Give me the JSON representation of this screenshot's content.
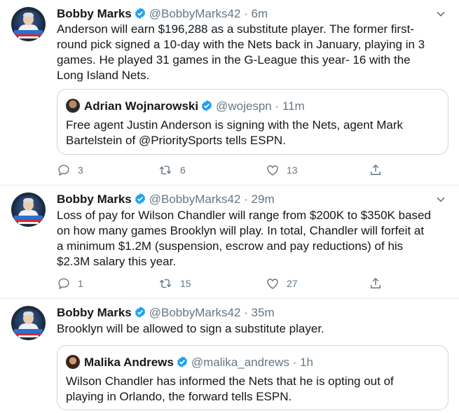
{
  "tweets": [
    {
      "name": "Bobby Marks",
      "handle": "@BobbyMarks42",
      "time": "6m",
      "lines": [
        "Anderson will earn $196,288 as a substitute player. The former first-",
        "round pick signed a 10-day with the Nets back in January, playing in 3",
        "games. He played 31 games in the G-League this year- 16 with the",
        "Long Island Nets."
      ],
      "quote": {
        "name": "Adrian Wojnarowski",
        "handle": "@wojespn",
        "time": "11m",
        "lines": [
          "Free agent Justin Anderson is signing with the Nets, agent Mark",
          "Bartelstein of @PrioritySports tells ESPN."
        ]
      },
      "replies": "3",
      "retweets": "6",
      "likes": "13"
    },
    {
      "name": "Bobby Marks",
      "handle": "@BobbyMarks42",
      "time": "29m",
      "lines": [
        "Loss of pay for Wilson Chandler will range from $200K to $350K based",
        "on how many games Brooklyn will play. In total, Chandler will forfeit at",
        "a minimum $1.2M (suspension, escrow and pay reductions) of his",
        "$2.3M salary this year."
      ],
      "replies": "1",
      "retweets": "15",
      "likes": "27"
    },
    {
      "name": "Bobby Marks",
      "handle": "@BobbyMarks42",
      "time": "35m",
      "lines": [
        "Brooklyn will be allowed to sign a substitute player."
      ],
      "quote": {
        "name": "Malika Andrews",
        "handle": "@malika_andrews",
        "time": "1h",
        "lines": [
          "Wilson Chandler has informed the Nets that he is opting out of",
          "playing in Orlando, the forward tells ESPN."
        ]
      }
    }
  ],
  "separator": "·",
  "icons": {
    "verified": "verified-badge-icon",
    "more": "chevron-down-icon",
    "reply": "reply-icon",
    "retweet": "retweet-icon",
    "like": "heart-icon",
    "share": "share-icon"
  },
  "colors": {
    "verified": "#1da1f2",
    "muted": "#657786",
    "border": "#e6ecf0"
  }
}
